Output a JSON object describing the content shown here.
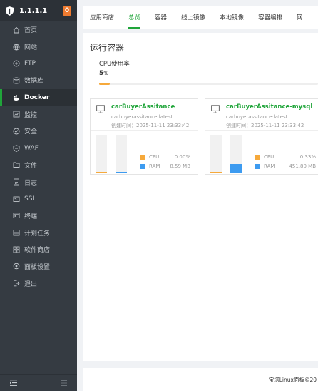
{
  "brand": {
    "ip": "1.1.1.1",
    "badge": "0"
  },
  "sidebar": {
    "items": [
      {
        "label": "首页",
        "icon": "home-icon"
      },
      {
        "label": "网站",
        "icon": "globe-icon"
      },
      {
        "label": "FTP",
        "icon": "ftp-icon"
      },
      {
        "label": "数据库",
        "icon": "database-icon"
      },
      {
        "label": "Docker",
        "icon": "docker-icon",
        "active": true
      },
      {
        "label": "监控",
        "icon": "monitor-icon"
      },
      {
        "label": "安全",
        "icon": "security-icon"
      },
      {
        "label": "WAF",
        "icon": "waf-icon"
      },
      {
        "label": "文件",
        "icon": "folder-icon"
      },
      {
        "label": "日志",
        "icon": "log-icon"
      },
      {
        "label": "SSL",
        "icon": "ssl-icon"
      },
      {
        "label": "终端",
        "icon": "terminal-icon"
      },
      {
        "label": "计划任务",
        "icon": "schedule-icon"
      },
      {
        "label": "软件商店",
        "icon": "store-icon"
      },
      {
        "label": "面板设置",
        "icon": "settings-icon"
      },
      {
        "label": "退出",
        "icon": "logout-icon"
      }
    ]
  },
  "tabs": [
    {
      "label": "应用商店"
    },
    {
      "label": "总览",
      "active": true
    },
    {
      "label": "容器"
    },
    {
      "label": "线上镜像"
    },
    {
      "label": "本地镜像"
    },
    {
      "label": "容器编排"
    },
    {
      "label": "网"
    }
  ],
  "overview": {
    "title": "运行容器",
    "cpu_label": "CPU使用率",
    "cpu_value": "5",
    "cpu_unit": "%",
    "cpu_percent": 5
  },
  "containers": [
    {
      "name": "carBuyerAssitance",
      "image": "carbuyerassitance:latest",
      "created": "创建时间：2025-11-11 23:33:42",
      "cpu_label": "CPU",
      "cpu_value": "0.00%",
      "cpu_level": 0.0,
      "ram_label": "RAM",
      "ram_value": "8.59 MB",
      "ram_level": 0.02
    },
    {
      "name": "carBuyerAssitance-mysql",
      "image": "carbuyerassitance:latest",
      "created": "创建时间：2025-11-11 23:33:42",
      "cpu_label": "CPU",
      "cpu_value": "0.33%",
      "cpu_level": 0.01,
      "ram_label": "RAM",
      "ram_value": "451.80 MB",
      "ram_level": 0.22
    }
  ],
  "footer": {
    "text": "宝塔Linux面板©20"
  },
  "colors": {
    "accent": "#20a53a",
    "cpu": "#f6a93b",
    "ram": "#3d9bf0",
    "sidebar_bg": "#353b42"
  }
}
